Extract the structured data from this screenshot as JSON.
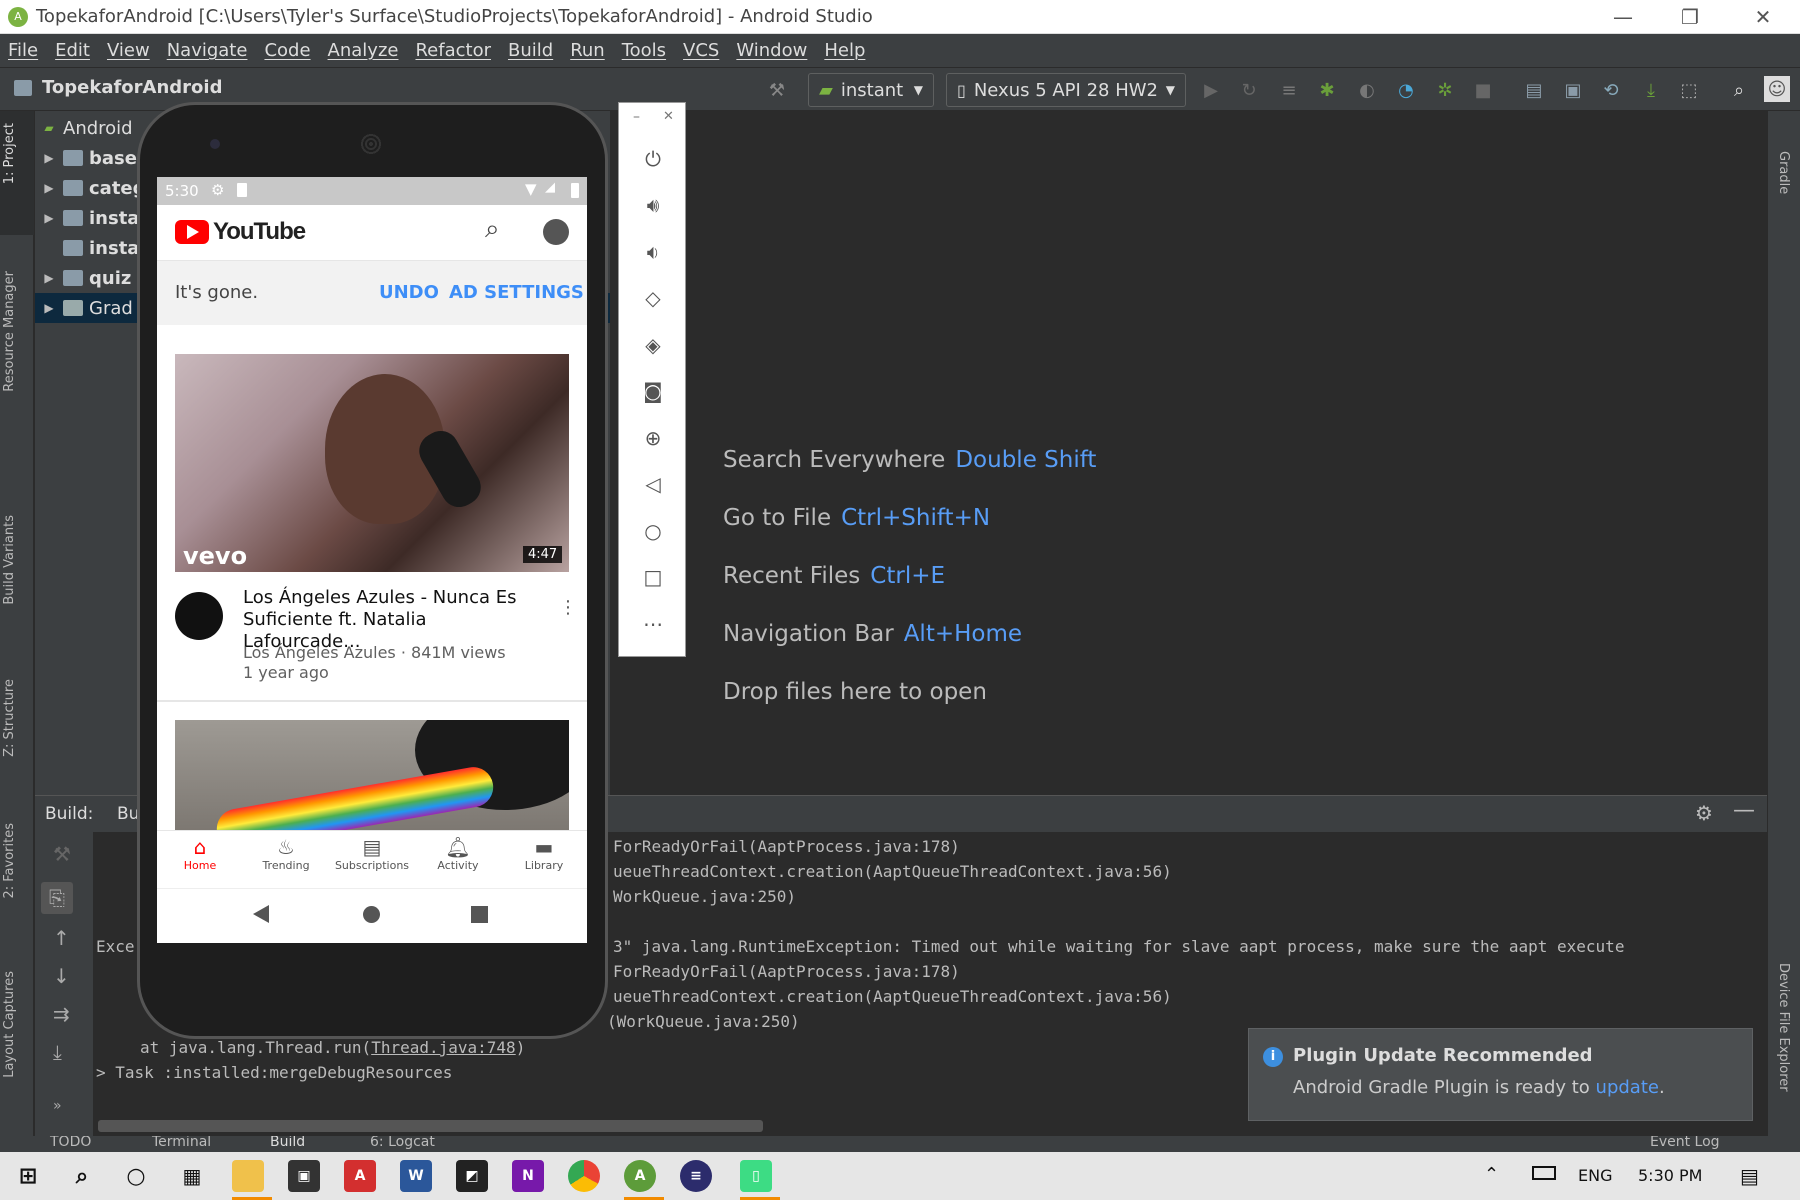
{
  "window": {
    "title": "TopekaforAndroid [C:\\Users\\Tyler's Surface\\StudioProjects\\TopekaforAndroid] - Android Studio"
  },
  "menu": [
    "File",
    "Edit",
    "View",
    "Navigate",
    "Code",
    "Analyze",
    "Refactor",
    "Build",
    "Run",
    "Tools",
    "VCS",
    "Window",
    "Help"
  ],
  "toolbar": {
    "project": "TopekaforAndroid",
    "config": "instant",
    "device": "Nexus 5 API 28 HW2"
  },
  "project_panel": {
    "header": "Android",
    "items": [
      "base",
      "categ",
      "insta",
      "insta",
      "quiz",
      "Grad"
    ]
  },
  "left_tabs": {
    "project": "1: Project",
    "resource": "Resource Manager",
    "variants": "Build Variants",
    "structure": "Z: Structure",
    "favorites": "2: Favorites",
    "captures": "Layout Captures"
  },
  "right_tabs": {
    "gradle": "Gradle",
    "device_explorer": "Device File Explorer"
  },
  "editor_hints": [
    {
      "label": "Search Everywhere",
      "key": "Double Shift"
    },
    {
      "label": "Go to File",
      "key": "Ctrl+Shift+N"
    },
    {
      "label": "Recent Files",
      "key": "Ctrl+E"
    },
    {
      "label": "Navigation Bar",
      "key": "Alt+Home"
    },
    {
      "label": "Drop files here to open",
      "key": ""
    }
  ],
  "build": {
    "label": "Build:",
    "tab": "Bu",
    "log": [
      "ForReadyOrFail(AaptProcess.java:178)",
      "ueueThreadContext.creation(AaptQueueThreadContext.java:56)",
      "WorkQueue.java:250)",
      "Exce",
      "3\" java.lang.RuntimeException: Timed out while waiting for slave aapt process, make sure the aapt execute",
      "ForReadyOrFail(AaptProcess.java:178)",
      "ueueThreadContext.creation(AaptQueueThreadContext.java:56)",
      "(WorkQueue.java:250)",
      "at java.lang.Thread.run(",
      "Thread.java:748",
      ")",
      "> Task :installed:mergeDebugResources"
    ]
  },
  "bottom_tabs": [
    "TODO",
    "Terminal",
    "Build",
    "6: Logcat",
    "Event Log"
  ],
  "notification": {
    "title": "Plugin Update Recommended",
    "body": "Android Gradle Plugin is ready to ",
    "link": "update",
    "end": "."
  },
  "phone": {
    "status_time": "5:30",
    "app_name": "YouTube",
    "banner": {
      "text": "It's gone.",
      "undo": "UNDO",
      "ad_settings": "AD SETTINGS"
    },
    "video": {
      "duration": "4:47",
      "brand": "vevo",
      "title": "Los Ángeles Azules - Nunca Es Suficiente ft. Natalia Lafourcade...",
      "channel_meta": "Los Ángeles Azules · 841M views",
      "age": "1 year ago"
    },
    "nav": [
      "Home",
      "Trending",
      "Subscriptions",
      "Activity",
      "Library"
    ]
  },
  "taskbar": {
    "lang": "ENG",
    "time": "5:30 PM"
  },
  "colors": {
    "accent_blue": "#589df6",
    "yt_red": "#ff0000",
    "yt_blue": "#3e8ef7"
  }
}
